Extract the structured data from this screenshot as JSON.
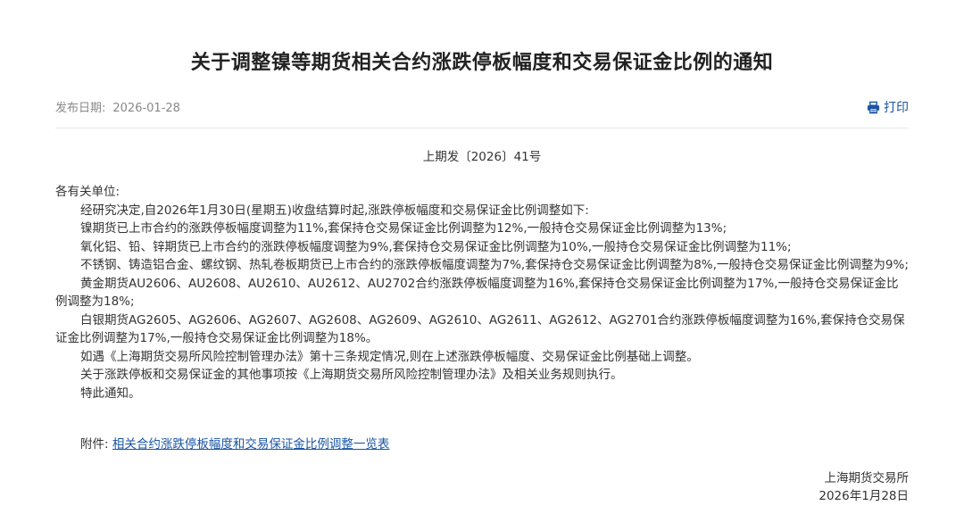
{
  "notice": {
    "title": "关于调整镍等期货相关合约涨跌停板幅度和交易保证金比例的通知",
    "publish_label": "发布日期:",
    "publish_date": "2026-01-28",
    "print_label": "打印",
    "doc_number": "上期发〔2026〕41号",
    "salutation": "各有关单位:",
    "paragraphs": [
      "经研究决定,自2026年1月30日(星期五)收盘结算时起,涨跌停板幅度和交易保证金比例调整如下:",
      "镍期货已上市合约的涨跌停板幅度调整为11%,套保持仓交易保证金比例调整为12%,一般持仓交易保证金比例调整为13%;",
      "氧化铝、铅、锌期货已上市合约的涨跌停板幅度调整为9%,套保持仓交易保证金比例调整为10%,一般持仓交易保证金比例调整为11%;",
      "不锈钢、铸造铝合金、螺纹钢、热轧卷板期货已上市合约的涨跌停板幅度调整为7%,套保持仓交易保证金比例调整为8%,一般持仓交易保证金比例调整为9%;",
      "黄金期货AU2606、AU2608、AU2610、AU2612、AU2702合约涨跌停板幅度调整为16%,套保持仓交易保证金比例调整为17%,一般持仓交易保证金比例调整为18%;",
      "白银期货AG2605、AG2606、AG2607、AG2608、AG2609、AG2610、AG2611、AG2612、AG2701合约涨跌停板幅度调整为16%,套保持仓交易保证金比例调整为17%,一般持仓交易保证金比例调整为18%。",
      "如遇《上海期货交易所风险控制管理办法》第十三条规定情况,则在上述涨跌停板幅度、交易保证金比例基础上调整。",
      "关于涨跌停板和交易保证金的其他事项按《上海期货交易所风险控制管理办法》及相关业务规则执行。",
      "特此通知。"
    ],
    "attachment_label": "附件:",
    "attachment_link": "相关合约涨跌停板幅度和交易保证金比例调整一览表",
    "signature_org": "上海期货交易所",
    "signature_date": "2026年1月28日"
  },
  "colors": {
    "link": "#1a55a3",
    "text": "#333333",
    "muted": "#888888"
  },
  "icons": {
    "print": "printer-icon"
  }
}
